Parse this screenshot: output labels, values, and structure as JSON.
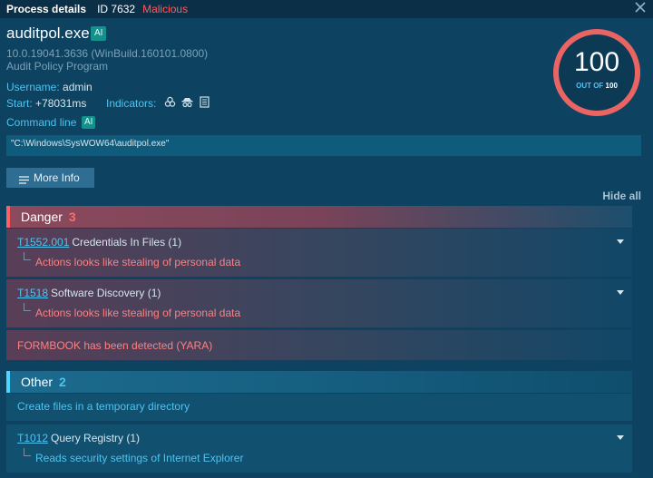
{
  "titlebar": {
    "title": "Process details",
    "id_text": "ID 7632",
    "verdict": "Malicious"
  },
  "process": {
    "name": "auditpol.exe",
    "ai_badge": "AI",
    "version": "10.0.19041.3636 (WinBuild.160101.0800)",
    "description": "Audit Policy Program",
    "username_label": "Username:",
    "username": "admin",
    "start_label": "Start:",
    "start": "+78031ms",
    "indicators_label": "Indicators:",
    "indicator_icons": [
      "biohazard-icon",
      "spy-icon",
      "registry-icon"
    ],
    "command_line_label": "Command line",
    "command_line": "\"C:\\Windows\\SysWOW64\\auditpol.exe\""
  },
  "score": {
    "value": "100",
    "out_of_label": "OUT OF",
    "max": "100",
    "color": "#ea6464"
  },
  "buttons": {
    "more_info": "More Info",
    "hide_all": "Hide all"
  },
  "danger": {
    "label": "Danger",
    "count": "3",
    "items": [
      {
        "code": "T1552.001",
        "title": "Credentials In Files (1)",
        "detail": "Actions looks like stealing of personal data"
      },
      {
        "code": "T1518",
        "title": "Software Discovery (1)",
        "detail": "Actions looks like stealing of personal data"
      },
      {
        "text": "FORMBOOK has been detected (YARA)"
      }
    ]
  },
  "other": {
    "label": "Other",
    "count": "2",
    "items": [
      {
        "text": "Create files in a temporary directory"
      },
      {
        "code": "T1012",
        "title": "Query Registry (1)",
        "detail": "Reads security settings of Internet Explorer"
      }
    ]
  }
}
